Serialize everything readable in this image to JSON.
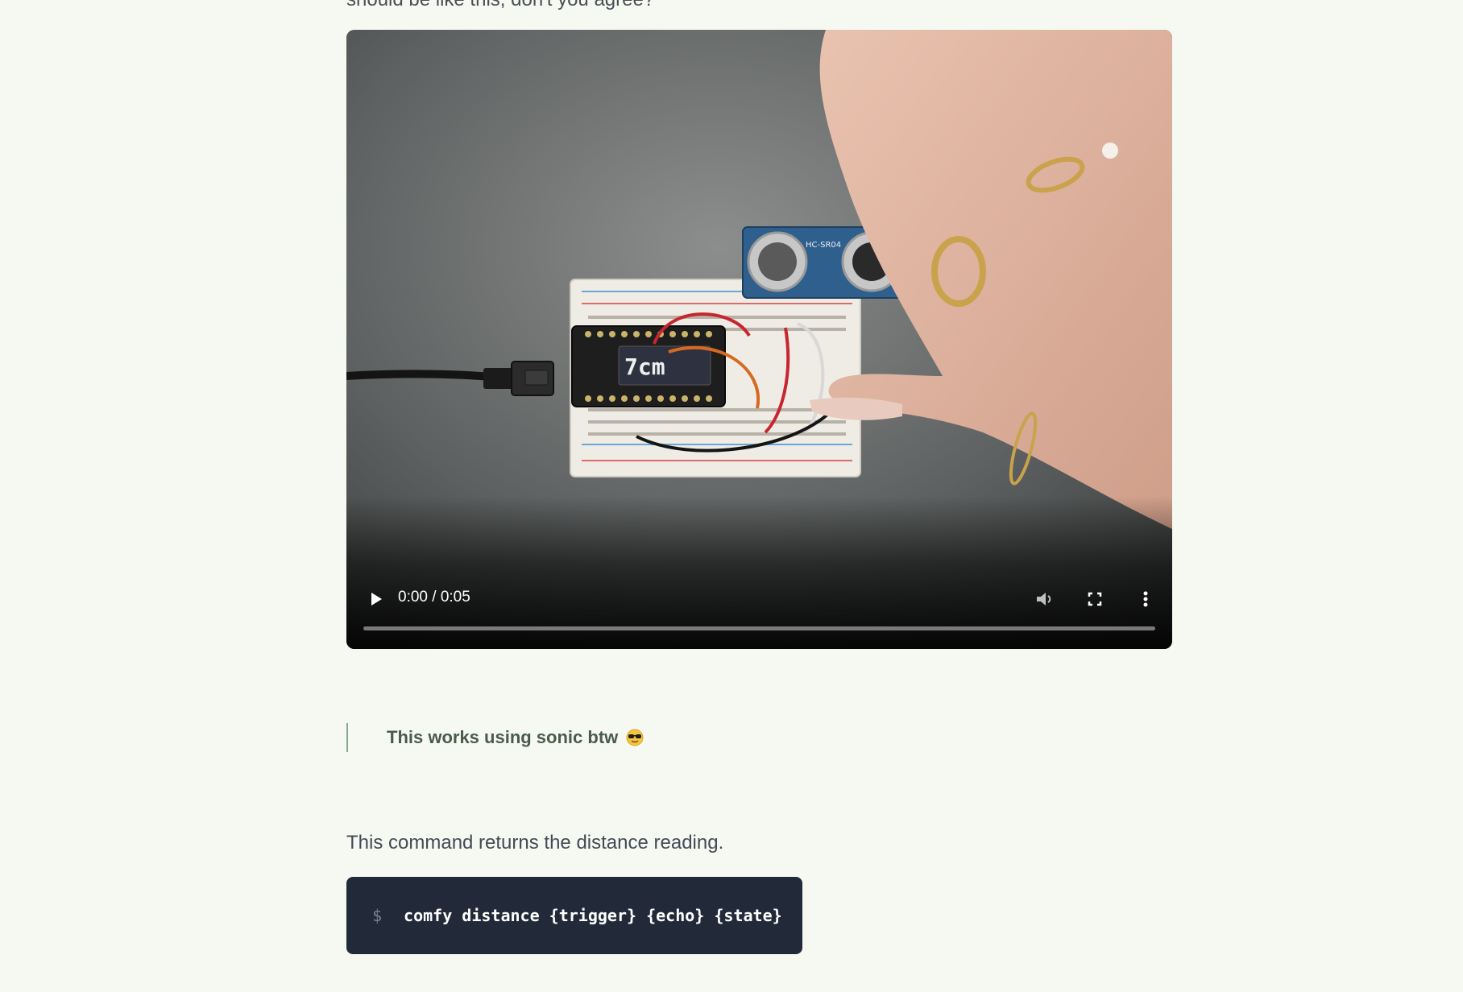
{
  "intro": {
    "text": "should be like this, don't you agree?"
  },
  "video": {
    "screen_reading": "7cm",
    "sensor_label": "HC-SR04",
    "time_display": "0:00 / 0:05",
    "progress": 0,
    "controls": {
      "play_icon": "play-icon",
      "mute_icon": "volume-icon",
      "fullscreen_icon": "fullscreen-icon",
      "more_icon": "more-vertical-icon"
    }
  },
  "quote": {
    "text": "This works using sonic btw",
    "emoji": "sunglasses-emoji"
  },
  "paragraph": {
    "text": "This command returns the distance reading."
  },
  "code": {
    "prompt": "$",
    "command": "comfy distance {trigger} {echo} {state}"
  },
  "colors": {
    "background": "#f6f9f2",
    "code_background": "#222a3a",
    "quote_border": "#86a98a"
  }
}
